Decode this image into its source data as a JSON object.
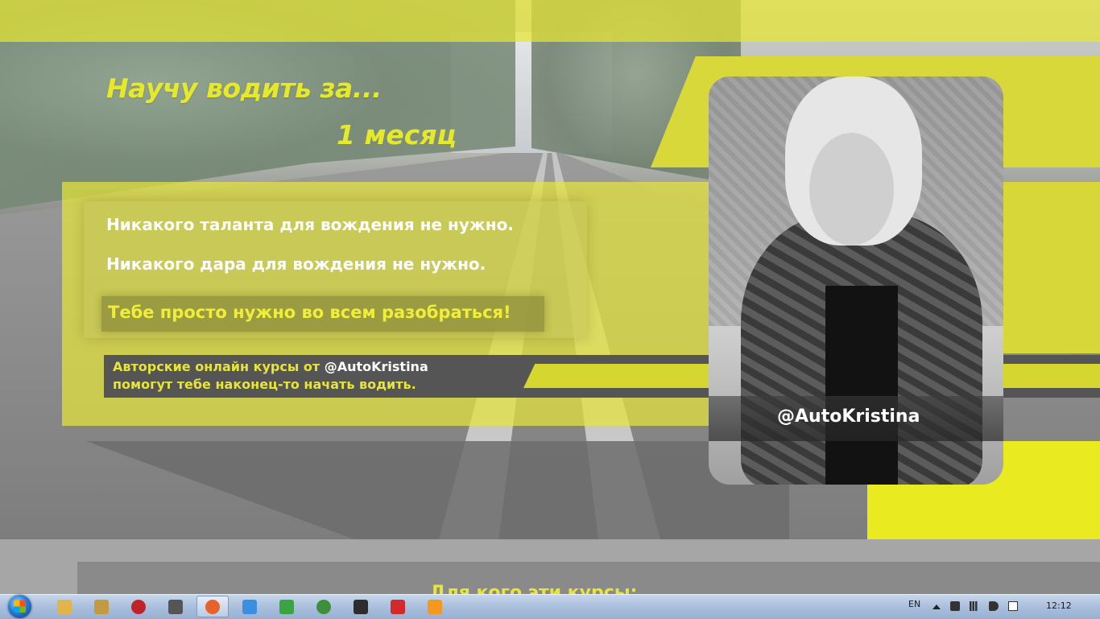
{
  "hero": {
    "headline_line1": "Научу водить за...",
    "headline_line2": "1 месяц"
  },
  "card": {
    "line1": "Никакого таланта для вождения не нужно.",
    "line2": "Никакого дара для вождения не нужно.",
    "cta": "Тебе просто нужно во всем разобраться!"
  },
  "courses": {
    "line1_prefix": "Авторские онлайн курсы от ",
    "line1_handle": "@AutoKristina",
    "line2": "помогут тебе наконец-то начать водить."
  },
  "photo": {
    "caption": "@AutoKristina"
  },
  "next_section": {
    "heading": "Для кого эти курсы:"
  },
  "taskbar": {
    "items": [
      {
        "name": "explorer-icon",
        "color": "#e3b44a"
      },
      {
        "name": "tool-icon",
        "color": "#c29b40"
      },
      {
        "name": "media-icon",
        "color": "#c0222a"
      },
      {
        "name": "app-icon",
        "color": "#555555"
      },
      {
        "name": "firefox-icon",
        "color": "#e8632b"
      },
      {
        "name": "finder-icon",
        "color": "#3b8fe0"
      },
      {
        "name": "download-icon",
        "color": "#3aa342"
      },
      {
        "name": "chrome-icon",
        "color": "#3f8e3c"
      },
      {
        "name": "shield-icon",
        "color": "#2d2d2d"
      },
      {
        "name": "yandex-icon",
        "color": "#d22a2a"
      },
      {
        "name": "sublime-icon",
        "color": "#f39a1d"
      }
    ],
    "language": "EN",
    "clock": "12:12"
  },
  "colors": {
    "accent_yellow": "#e6e82a",
    "panel_yellow": "#e5e53c",
    "dark_gray": "#555555"
  }
}
